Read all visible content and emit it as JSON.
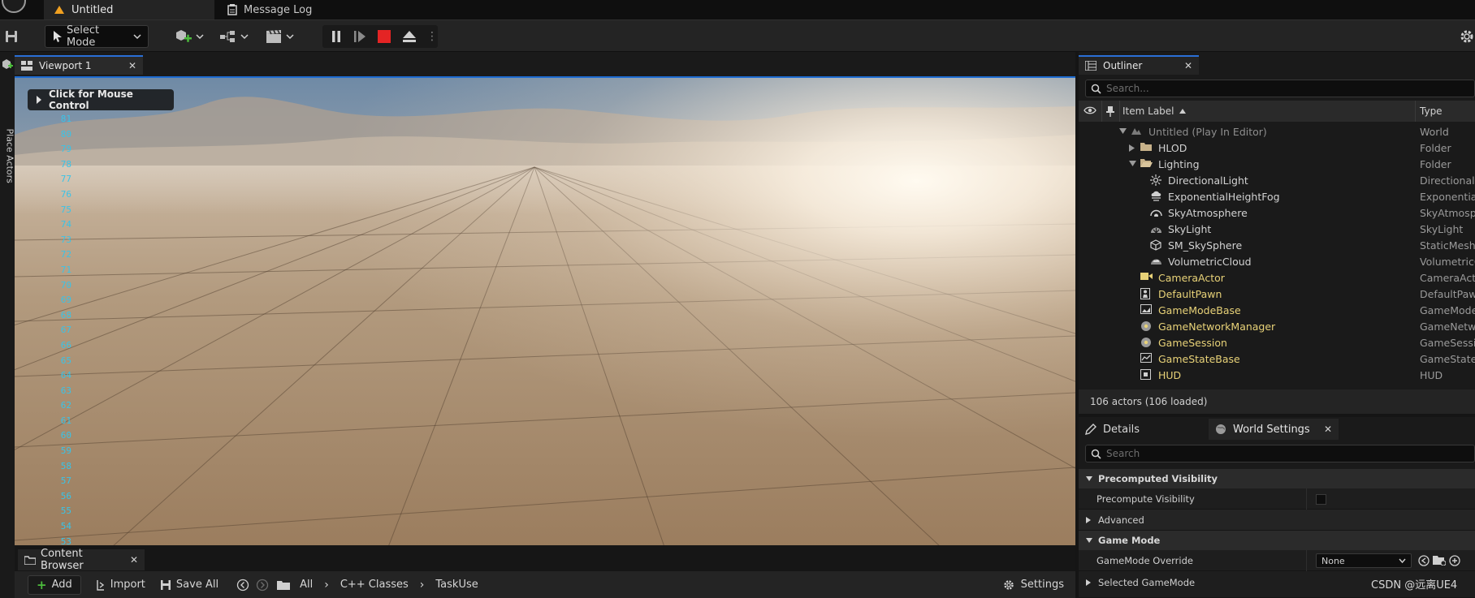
{
  "tabs": [
    {
      "label": "Untitled",
      "active": true
    },
    {
      "label": "Message Log",
      "active": false
    }
  ],
  "toolbar": {
    "select_mode_label": "Select Mode"
  },
  "left_strip": {
    "label": "Place Actors"
  },
  "viewport": {
    "tab_label": "Viewport 1",
    "mouse_control_label": "Click for Mouse Control",
    "ruler_numbers": [
      "81",
      "80",
      "79",
      "78",
      "77",
      "76",
      "75",
      "74",
      "73",
      "72",
      "71",
      "70",
      "69",
      "68",
      "67",
      "66",
      "65",
      "64",
      "63",
      "62",
      "61",
      "60",
      "59",
      "58",
      "57",
      "56",
      "55",
      "54",
      "53",
      "52",
      "51",
      "50"
    ]
  },
  "content_browser": {
    "tab_label": "Content Browser",
    "add_label": "Add",
    "import_label": "Import",
    "save_all_label": "Save All",
    "breadcrumb": [
      "All",
      "C++ Classes",
      "TaskUse"
    ],
    "settings_label": "Settings"
  },
  "outliner": {
    "tab_label": "Outliner",
    "search_placeholder": "Search...",
    "col_item_label": "Item Label",
    "col_type": "Type",
    "items": [
      {
        "label": "Untitled (Play In Editor)",
        "type": "World",
        "depth": 0,
        "icon": "world-icon",
        "expander": "open",
        "dim": true
      },
      {
        "label": "HLOD",
        "type": "Folder",
        "depth": 1,
        "icon": "folder-icon",
        "expander": "closed"
      },
      {
        "label": "Lighting",
        "type": "Folder",
        "depth": 1,
        "icon": "folder-open-icon",
        "expander": "open"
      },
      {
        "label": "DirectionalLight",
        "type": "DirectionalLi",
        "depth": 2,
        "icon": "sun-icon"
      },
      {
        "label": "ExponentialHeightFog",
        "type": "Exponential",
        "depth": 2,
        "icon": "fog-icon"
      },
      {
        "label": "SkyAtmosphere",
        "type": "SkyAtmosp",
        "depth": 2,
        "icon": "atmosphere-icon"
      },
      {
        "label": "SkyLight",
        "type": "SkyLight",
        "depth": 2,
        "icon": "skylight-icon"
      },
      {
        "label": "SM_SkySphere",
        "type": "StaticMesh",
        "depth": 2,
        "icon": "mesh-icon"
      },
      {
        "label": "VolumetricCloud",
        "type": "VolumetricC",
        "depth": 2,
        "icon": "cloud-icon"
      },
      {
        "label": "CameraActor",
        "type": "CameraActo",
        "depth": 1,
        "icon": "camera-icon",
        "highlight": true
      },
      {
        "label": "DefaultPawn",
        "type": "DefaultPaw",
        "depth": 1,
        "icon": "pawn-icon",
        "highlight": true
      },
      {
        "label": "GameModeBase",
        "type": "GameMode",
        "depth": 1,
        "icon": "gamemode-icon",
        "highlight": true
      },
      {
        "label": "GameNetworkManager",
        "type": "GameNetw",
        "depth": 1,
        "icon": "network-icon",
        "highlight": true
      },
      {
        "label": "GameSession",
        "type": "GameSessi",
        "depth": 1,
        "icon": "session-icon",
        "highlight": true
      },
      {
        "label": "GameStateBase",
        "type": "GameState",
        "depth": 1,
        "icon": "gamestate-icon",
        "highlight": true
      },
      {
        "label": "HUD",
        "type": "HUD",
        "depth": 1,
        "icon": "hud-icon",
        "highlight": true
      }
    ],
    "footer": "106 actors (106 loaded)"
  },
  "details": {
    "tab_details": "Details",
    "tab_world_settings": "World Settings",
    "search_placeholder": "Search",
    "cat_precomputed": "Precomputed Visibility",
    "prop_precompute": "Precompute Visibility",
    "cat_advanced": "Advanced",
    "cat_gamemode": "Game Mode",
    "prop_gamemode_override": "GameMode Override",
    "gamemode_value": "None",
    "prop_selected_gamemode": "Selected GameMode"
  },
  "watermark": "CSDN @远离UE4",
  "colors": {
    "accent": "#2a6fd6",
    "highlight_text": "#e8d278",
    "ruler": "#39c3e8"
  }
}
